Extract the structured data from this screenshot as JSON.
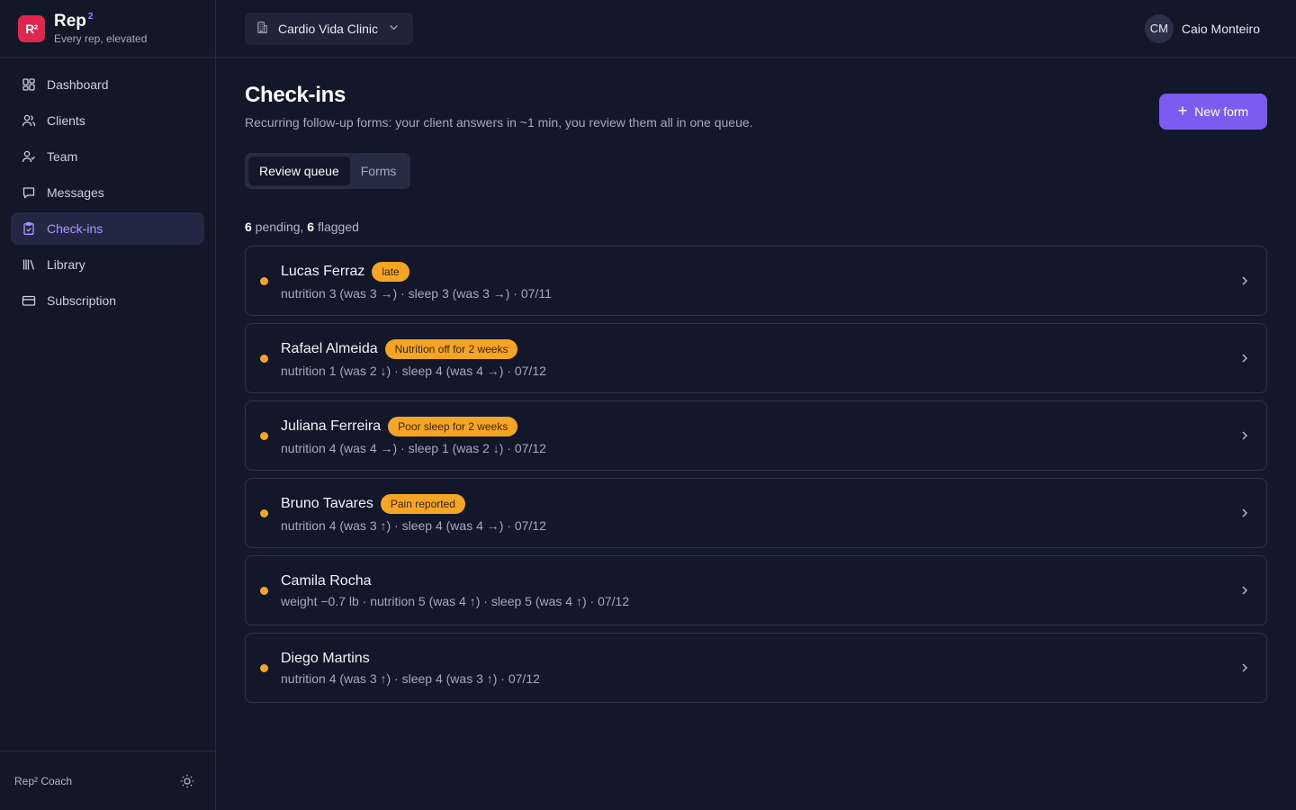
{
  "brand": {
    "logo": "R²",
    "name": "Rep",
    "sup": "2",
    "tagline": "Every rep, elevated"
  },
  "sidebar": {
    "items": [
      {
        "label": "Dashboard",
        "icon": "dashboard-icon"
      },
      {
        "label": "Clients",
        "icon": "clients-icon"
      },
      {
        "label": "Team",
        "icon": "team-icon"
      },
      {
        "label": "Messages",
        "icon": "messages-icon"
      },
      {
        "label": "Check-ins",
        "icon": "clipboard-check-icon",
        "active": true
      },
      {
        "label": "Library",
        "icon": "library-icon"
      },
      {
        "label": "Subscription",
        "icon": "credit-card-icon"
      }
    ],
    "footer_label": "Rep² Coach"
  },
  "topbar": {
    "clinic": "Cardio Vida Clinic",
    "user": {
      "initials": "CM",
      "name": "Caio Monteiro"
    }
  },
  "page": {
    "title": "Check-ins",
    "subtitle": "Recurring follow-up forms: your client answers in ~1 min, you review them all in one queue.",
    "new_button": "New form",
    "tabs": [
      "Review queue",
      "Forms"
    ],
    "active_tab": "Review queue"
  },
  "summary": {
    "pending_count": "6",
    "pending_label": " pending, ",
    "flagged_count": "6",
    "flagged_label": " flagged"
  },
  "checkins": [
    {
      "name": "Lucas Ferraz",
      "badge": "late",
      "meta": "nutrition 3 (was 3 →) · sleep 3 (was 3 →) · 07/11"
    },
    {
      "name": "Rafael Almeida",
      "badge": "Nutrition off for 2 weeks",
      "meta": "nutrition 1 (was 2 ↓) · sleep 4 (was 4 →) · 07/12"
    },
    {
      "name": "Juliana Ferreira",
      "badge": "Poor sleep for 2 weeks",
      "meta": "nutrition 4 (was 4 →) · sleep 1 (was 2 ↓) · 07/12"
    },
    {
      "name": "Bruno Tavares",
      "badge": "Pain reported",
      "meta": "nutrition 4 (was 3 ↑) · sleep 4 (was 4 →) · 07/12"
    },
    {
      "name": "Camila Rocha",
      "badge": "",
      "meta": "weight −0.7 lb · nutrition 5 (was 4 ↑) · sleep 5 (was 4 ↑) · 07/12"
    },
    {
      "name": "Diego Martins",
      "badge": "",
      "meta": "nutrition 4 (was 3 ↑) · sleep 4 (was 3 ↑) · 07/12"
    }
  ],
  "colors": {
    "accent": "#7c5cf0",
    "status_dot": "#f5a524",
    "badge": "#f5a524",
    "logo": "#e0264f"
  }
}
